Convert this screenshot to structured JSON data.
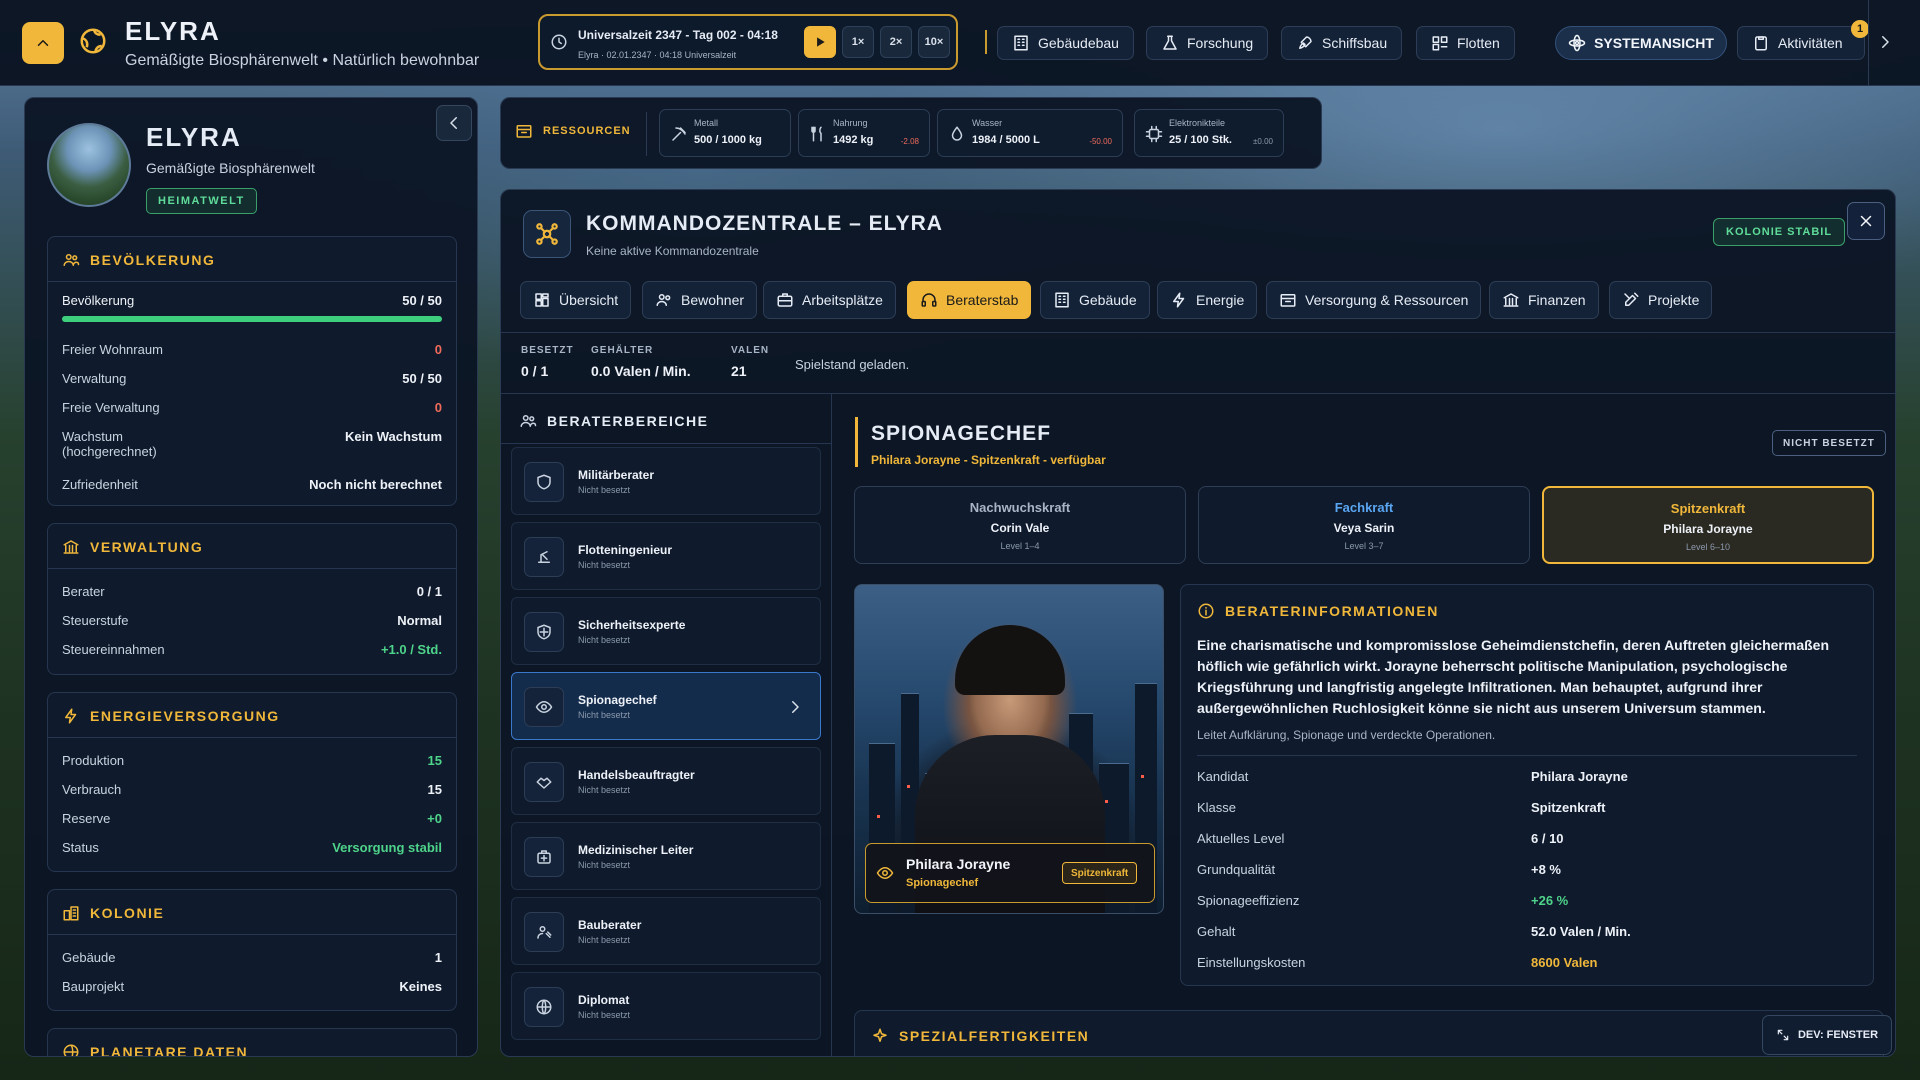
{
  "topbar": {
    "planet_name": "ELYRA",
    "planet_subtitle": "Gemäßigte Biosphärenwelt  •  Natürlich bewohnbar",
    "time_title": "Universalzeit 2347 - Tag 002 - 04:18",
    "time_sub": "Elyra · 02.01.2347 · 04:18 Universalzeit",
    "speeds": [
      "1×",
      "2×",
      "10×"
    ],
    "nav": [
      {
        "label": "Gebäudebau",
        "icon": "building-icon"
      },
      {
        "label": "Forschung",
        "icon": "flask-icon"
      },
      {
        "label": "Schiffsbau",
        "icon": "rocket-icon"
      },
      {
        "label": "Flotten",
        "icon": "fleet-icon"
      }
    ],
    "system_view": "SYSTEMANSICHT",
    "activities": "Aktivitäten",
    "activities_badge": "1"
  },
  "left": {
    "name": "ELYRA",
    "subtitle": "Gemäßigte Biosphärenwelt",
    "badge": "HEIMATWELT",
    "population": {
      "title": "BEVÖLKERUNG",
      "label": "Bevölkerung",
      "value": "50 / 50",
      "fill_fraction": 1.0,
      "rows": [
        {
          "label": "Freier Wohnraum",
          "value": "0",
          "color": "#ef6a5a"
        },
        {
          "label": "Verwaltung",
          "value": "50 / 50"
        },
        {
          "label": "Freie Verwaltung",
          "value": "0",
          "color": "#ef6a5a"
        },
        {
          "label": "Wachstum",
          "label2": "(hochgerechnet)",
          "value": "Kein Wachstum"
        },
        {
          "label": "Zufriedenheit",
          "value": "Noch nicht berechnet"
        }
      ]
    },
    "admin": {
      "title": "VERWALTUNG",
      "rows": [
        {
          "label": "Berater",
          "value": "0 / 1"
        },
        {
          "label": "Steuerstufe",
          "value": "Normal"
        },
        {
          "label": "Steuereinnahmen",
          "value": "+1.0 / Std.",
          "color": "#4ed38a"
        }
      ]
    },
    "energy": {
      "title": "ENERGIEVERSORGUNG",
      "rows": [
        {
          "label": "Produktion",
          "value": "15",
          "color": "#4ed38a"
        },
        {
          "label": "Verbrauch",
          "value": "15"
        },
        {
          "label": "Reserve",
          "value": "+0",
          "color": "#4ed38a"
        },
        {
          "label": "Status",
          "value": "Versorgung stabil",
          "color": "#4ed38a"
        }
      ]
    },
    "colony": {
      "title": "KOLONIE",
      "rows": [
        {
          "label": "Gebäude",
          "value": "1"
        },
        {
          "label": "Bauprojekt",
          "value": "Keines"
        }
      ]
    },
    "planet_data_title": "PLANETARE DATEN"
  },
  "resources": {
    "label": "RESSOURCEN",
    "items": [
      {
        "name": "Metall",
        "value": "500 / 1000 kg",
        "delta": "",
        "icon": "pickaxe-icon"
      },
      {
        "name": "Nahrung",
        "value": "1492 kg",
        "delta": "-2.08",
        "icon": "fork-knife-icon"
      },
      {
        "name": "Wasser",
        "value": "1984 / 5000 L",
        "delta": "-50.00",
        "icon": "drop-icon"
      },
      {
        "name": "Elektronikteile",
        "value": "25 / 100 Stk.",
        "delta": "±0.00",
        "icon": "chip-icon"
      }
    ]
  },
  "main": {
    "title": "KOMMANDOZENTRALE – ELYRA",
    "subtitle": "Keine aktive Kommandozentrale",
    "status_badge": "KOLONIE STABIL",
    "tabs": [
      {
        "label": "Übersicht",
        "icon": "overview-icon"
      },
      {
        "label": "Bewohner",
        "icon": "people-icon"
      },
      {
        "label": "Arbeitsplätze",
        "icon": "briefcase-icon"
      },
      {
        "label": "Beraterstab",
        "icon": "headset-icon",
        "active": true
      },
      {
        "label": "Gebäude",
        "icon": "building-icon"
      },
      {
        "label": "Energie",
        "icon": "bolt-icon"
      },
      {
        "label": "Versorgung & Ressourcen",
        "icon": "crate-icon"
      },
      {
        "label": "Finanzen",
        "icon": "bank-icon"
      },
      {
        "label": "Projekte",
        "icon": "tools-icon"
      }
    ],
    "stats": [
      {
        "label": "BESETZT",
        "value": "0 / 1"
      },
      {
        "label": "GEHÄLTER",
        "value": "0.0 Valen / Min."
      },
      {
        "label": "VALEN",
        "value": "21"
      }
    ],
    "message": "Spielstand geladen.",
    "advisor_header": "BERATERBEREICHE",
    "advisors": [
      {
        "name": "Militärberater",
        "status": "Nicht besetzt",
        "icon": "shield-icon"
      },
      {
        "name": "Flotteningenieur",
        "status": "Nicht besetzt",
        "icon": "engineer-icon"
      },
      {
        "name": "Sicherheitsexperte",
        "status": "Nicht besetzt",
        "icon": "security-shield-icon"
      },
      {
        "name": "Spionagechef",
        "status": "Nicht besetzt",
        "icon": "eye-icon",
        "active": true
      },
      {
        "name": "Handelsbeauftragter",
        "status": "Nicht besetzt",
        "icon": "handshake-icon"
      },
      {
        "name": "Medizinischer Leiter",
        "status": "Nicht besetzt",
        "icon": "medical-kit-icon"
      },
      {
        "name": "Bauberater",
        "status": "Nicht besetzt",
        "icon": "builder-icon"
      },
      {
        "name": "Diplomat",
        "status": "Nicht besetzt",
        "icon": "globe-icon"
      }
    ],
    "detail": {
      "title": "SPIONAGECHEF",
      "subtitle": "Philara Jorayne - Spitzenkraft - verfügbar",
      "badge": "NICHT BESETZT",
      "tiers": [
        {
          "name": "Nachwuchskraft",
          "person": "Corin Vale",
          "level": "Level 1–4",
          "color": "#a8b5c6"
        },
        {
          "name": "Fachkraft",
          "person": "Veya Sarin",
          "level": "Level 3–7",
          "color": "#5aa6f2"
        },
        {
          "name": "Spitzenkraft",
          "person": "Philara Jorayne",
          "level": "Level 6–10",
          "color": "#f0b73a",
          "active": true
        }
      ],
      "portrait": {
        "name": "Philara Jorayne",
        "role": "Spionagechef",
        "tier": "Spitzenkraft"
      },
      "info": {
        "title": "BERATERINFORMATIONEN",
        "description": "Eine charismatische und kompromisslose Geheimdienstchefin, deren Auftreten gleichermaßen höflich wie gefährlich wirkt. Jorayne beherrscht politische Manipulation, psychologische Kriegsführung und langfristig angelegte Infiltrationen. Man behauptet, aufgrund ihrer außergewöhnlichen Ruchlosigkeit könne sie nicht aus unserem Universum stammen.",
        "note": "Leitet Aufklärung, Spionage und verdeckte Operationen.",
        "rows": [
          {
            "label": "Kandidat",
            "value": "Philara Jorayne"
          },
          {
            "label": "Klasse",
            "value": "Spitzenkraft"
          },
          {
            "label": "Aktuelles Level",
            "value": "6 / 10"
          },
          {
            "label": "Grundqualität",
            "value": "+8 %"
          },
          {
            "label": "Spionageeffizienz",
            "value": "+26 %",
            "color": "#4ed38a"
          },
          {
            "label": "Gehalt",
            "value": "52.0 Valen / Min."
          },
          {
            "label": "Einstellungskosten",
            "value": "8600 Valen",
            "color": "#f0b73a"
          }
        ]
      },
      "skills_title": "SPEZIALFERTIGKEITEN"
    },
    "dev_button": "DEV: FENSTER"
  }
}
